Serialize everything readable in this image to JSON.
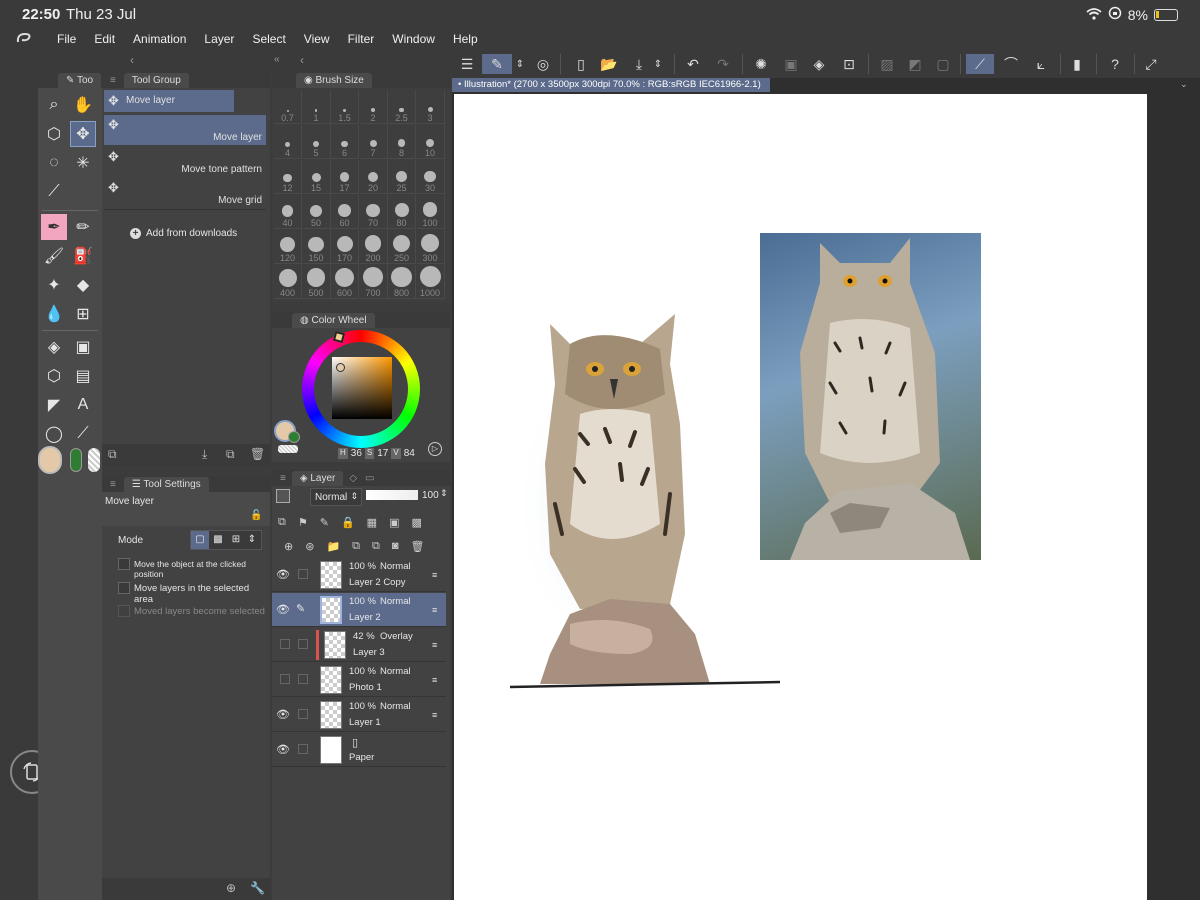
{
  "status": {
    "time": "22:50",
    "date": "Thu 23 Jul",
    "battery": "8%"
  },
  "menu": [
    "File",
    "Edit",
    "Animation",
    "Layer",
    "Select",
    "View",
    "Filter",
    "Window",
    "Help"
  ],
  "tool_palette": {
    "tab": "Too"
  },
  "sub_tool": {
    "tab": "Tool Group",
    "header_item": "Move layer",
    "items": [
      "Move layer",
      "Move tone pattern",
      "Move grid"
    ],
    "add_label": "Add from downloads"
  },
  "brush_size": {
    "tab": "Brush Size",
    "sizes": [
      "0.7",
      "1",
      "1.5",
      "2",
      "2.5",
      "3",
      "4",
      "5",
      "6",
      "7",
      "8",
      "10",
      "12",
      "15",
      "17",
      "20",
      "25",
      "30",
      "40",
      "50",
      "60",
      "70",
      "80",
      "100",
      "120",
      "150",
      "170",
      "200",
      "250",
      "300",
      "400",
      "500",
      "600",
      "700",
      "800",
      "1000"
    ]
  },
  "color_wheel": {
    "tab": "Color Wheel",
    "h_label": "H",
    "h": "36",
    "s_label": "S",
    "s": "17",
    "v_label": "V",
    "v": "84",
    "main_color": "#e3c9a8",
    "sub_color": "#2e7d32"
  },
  "tool_settings": {
    "tab": "Tool Settings",
    "title": "Move layer",
    "mode_label": "Mode",
    "options": [
      "Move the object at the clicked position",
      "Move layers in the selected area",
      "Moved layers become selected"
    ]
  },
  "layer": {
    "tab": "Layer",
    "blend": "Normal",
    "opacity": "100",
    "rows": [
      {
        "opacity": "100 %",
        "mode": "Normal",
        "name": "Layer 2 Copy"
      },
      {
        "opacity": "100 %",
        "mode": "Normal",
        "name": "Layer 2"
      },
      {
        "opacity": "42 %",
        "mode": "Overlay",
        "name": "Layer 3"
      },
      {
        "opacity": "100 %",
        "mode": "Normal",
        "name": "Photo 1"
      },
      {
        "opacity": "100 %",
        "mode": "Normal",
        "name": "Layer 1"
      },
      {
        "opacity": "",
        "mode": "",
        "name": "Paper"
      }
    ]
  },
  "document": {
    "tab_title": "Illustration* (2700 x 3500px 300dpi 70.0% : RGB:sRGB IEC61966-2.1)"
  }
}
